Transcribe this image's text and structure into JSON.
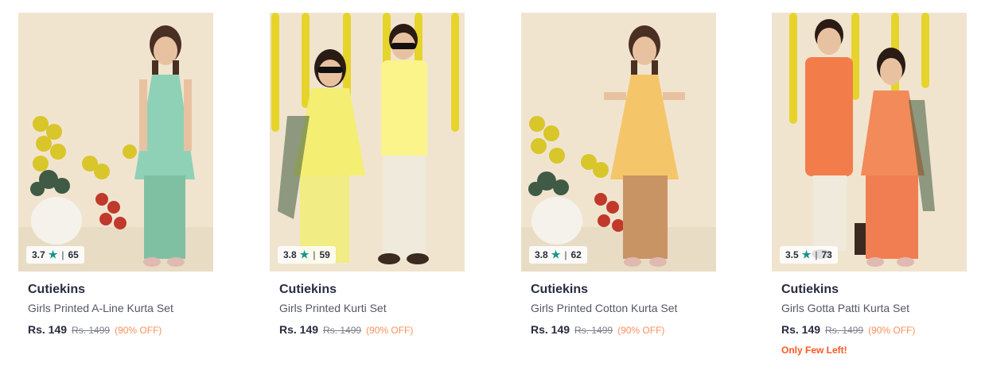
{
  "colors": {
    "rating_star": "#14958f",
    "discount": "#ff905a",
    "few_left": "#ff5722",
    "photo_bg": "#f1e4cf"
  },
  "products": [
    {
      "brand": "Cutiekins",
      "title": "Girls Printed A-Line Kurta Set",
      "rating": "3.7",
      "rating_count": "65",
      "price": "Rs. 149",
      "mrp": "Rs. 1499",
      "discount": "(90% OFF)",
      "stock_note": ""
    },
    {
      "brand": "Cutiekins",
      "title": "Girls Printed Kurti Set",
      "rating": "3.8",
      "rating_count": "59",
      "price": "Rs. 149",
      "mrp": "Rs. 1499",
      "discount": "(90% OFF)",
      "stock_note": ""
    },
    {
      "brand": "Cutiekins",
      "title": "Girls Printed Cotton Kurta Set",
      "rating": "3.8",
      "rating_count": "62",
      "price": "Rs. 149",
      "mrp": "Rs. 1499",
      "discount": "(90% OFF)",
      "stock_note": ""
    },
    {
      "brand": "Cutiekins",
      "title": "Girls Gotta Patti Kurta Set",
      "rating": "3.5",
      "rating_count": "73",
      "price": "Rs. 149",
      "mrp": "Rs. 1499",
      "discount": "(90% OFF)",
      "stock_note": "Only Few Left!"
    }
  ],
  "star_icon": "star-icon"
}
